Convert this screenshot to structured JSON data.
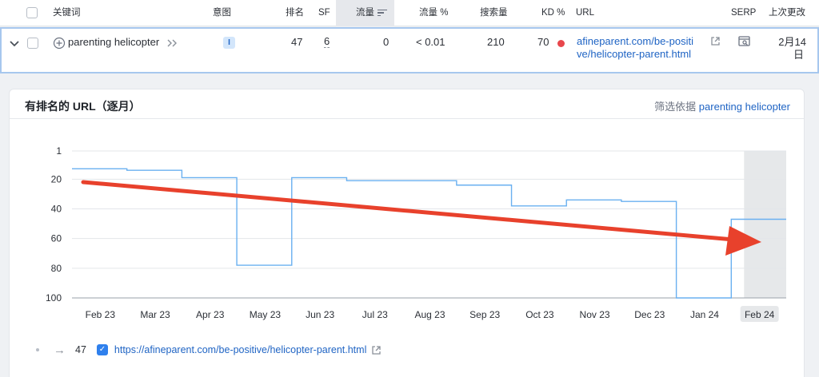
{
  "table": {
    "headers": {
      "keyword": "关键词",
      "intent": "意图",
      "rank": "排名",
      "sf": "SF",
      "traffic": "流量",
      "traffic_pct": "流量 %",
      "volume": "搜索量",
      "kd": "KD %",
      "url": "URL",
      "serp": "SERP",
      "last_update": "上次更改"
    },
    "row": {
      "keyword": "parenting helicopter",
      "intent": "I",
      "rank": "47",
      "sf": "6",
      "traffic": "0",
      "traffic_pct": "< 0.01",
      "volume": "210",
      "kd": "70",
      "url_line1": "afineparent.com/be-positi",
      "url_line2": "ve/helicopter-parent.html",
      "last_update_line1": "2月14",
      "last_update_line2": "日"
    }
  },
  "panel": {
    "title": "有排名的 URL（逐月）",
    "filter_label": "筛选依据 ",
    "filter_keyword": "parenting helicopter"
  },
  "chart_data": {
    "type": "line",
    "y_axis": {
      "reversed": true,
      "ylim": [
        1,
        100
      ],
      "ticks": [
        1,
        20,
        40,
        60,
        80,
        100
      ]
    },
    "x_labels": [
      "Feb 23",
      "Mar 23",
      "Apr 23",
      "May 23",
      "Jun 23",
      "Jul 23",
      "Aug 23",
      "Sep 23",
      "Oct 23",
      "Nov 23",
      "Dec 23",
      "Jan 24",
      "Feb 24"
    ],
    "highlighted_label": "Feb 24",
    "series": [
      {
        "color": "#6ab0f0",
        "segments": [
          {
            "from": 0,
            "to": 1.0,
            "rank": 13
          },
          {
            "from": 1.0,
            "to": 2.0,
            "rank": 14
          },
          {
            "from": 2.0,
            "to": 3.0,
            "rank": 19
          },
          {
            "from": 3.0,
            "to": 4.0,
            "rank": 78
          },
          {
            "from": 4.0,
            "to": 5.0,
            "rank": 19
          },
          {
            "from": 5.0,
            "to": 7.0,
            "rank": 21
          },
          {
            "from": 7.0,
            "to": 8.0,
            "rank": 24
          },
          {
            "from": 8.0,
            "to": 9.0,
            "rank": 38
          },
          {
            "from": 9.0,
            "to": 10.0,
            "rank": 34
          },
          {
            "from": 10.0,
            "to": 11.0,
            "rank": 35
          },
          {
            "from": 11.0,
            "to": 12.0,
            "rank": 100
          },
          {
            "from": 12.0,
            "to": 13.0,
            "rank": 47
          }
        ]
      }
    ],
    "annotation": {
      "kind": "trend-arrow",
      "color": "#e8412c"
    }
  },
  "legend": {
    "rank": "47",
    "url": "https://afineparent.com/be-positive/helicopter-parent.html"
  }
}
